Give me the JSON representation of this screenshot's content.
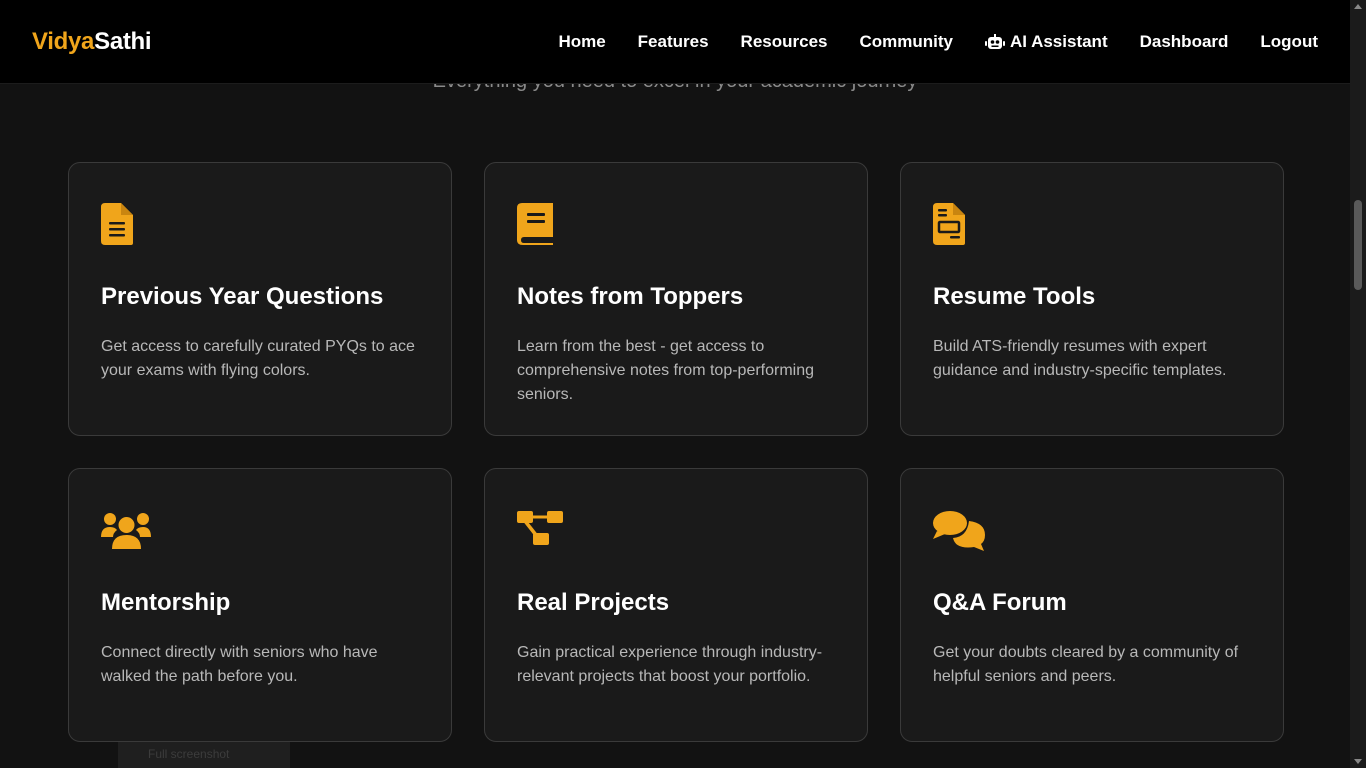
{
  "brand": {
    "name_part1": "Vidya",
    "name_part2": "Sathi",
    "accent_color": "#f0a51b"
  },
  "nav": {
    "items": [
      {
        "label": "Home"
      },
      {
        "label": "Features"
      },
      {
        "label": "Resources"
      },
      {
        "label": "Community"
      },
      {
        "label": "AI Assistant",
        "icon": "robot-icon"
      },
      {
        "label": "Dashboard"
      },
      {
        "label": "Logout"
      }
    ]
  },
  "section": {
    "subtitle": "Everything you need to excel in your academic journey"
  },
  "features": [
    {
      "icon": "file-lines-icon",
      "title": "Previous Year Questions",
      "description": "Get access to carefully curated PYQs to ace your exams with flying colors."
    },
    {
      "icon": "book-icon",
      "title": "Notes from Toppers",
      "description": "Learn from the best - get access to comprehensive notes from top-performing seniors."
    },
    {
      "icon": "file-invoice-icon",
      "title": "Resume Tools",
      "description": "Build ATS-friendly resumes with expert guidance and industry-specific templates."
    },
    {
      "icon": "users-icon",
      "title": "Mentorship",
      "description": "Connect directly with seniors who have walked the path before you."
    },
    {
      "icon": "diagram-project-icon",
      "title": "Real Projects",
      "description": "Gain practical experience through industry-relevant projects that boost your portfolio."
    },
    {
      "icon": "comments-icon",
      "title": "Q&A Forum",
      "description": "Get your doubts cleared by a community of helpful seniors and peers."
    }
  ],
  "footer_chip": {
    "label": "Full screenshot"
  }
}
